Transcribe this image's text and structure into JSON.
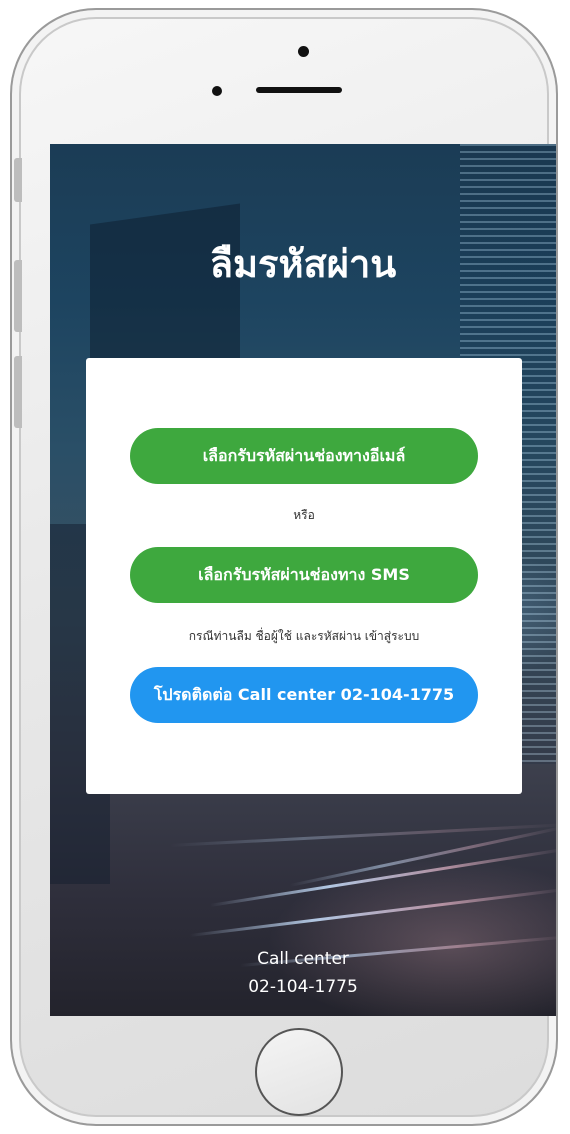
{
  "page": {
    "title": "ลืมรหัสผ่าน"
  },
  "card": {
    "email_button": "เลือกรับรหัสผ่านช่องทางอีเมล์",
    "or_text": "หรือ",
    "sms_button": "เลือกรับรหัสผ่านช่องทาง SMS",
    "note_text": "กรณีท่านลืม ชื่อผู้ใช้ และรหัสผ่าน เข้าสู่ระบบ",
    "call_button": "โปรดติดต่อ Call center 02-104-1775"
  },
  "footer": {
    "label": "Call center",
    "phone": "02-104-1775"
  },
  "colors": {
    "green_button": "#3ea83e",
    "blue_button": "#2196f0",
    "card_background": "#ffffff",
    "title_text": "#ffffff"
  }
}
